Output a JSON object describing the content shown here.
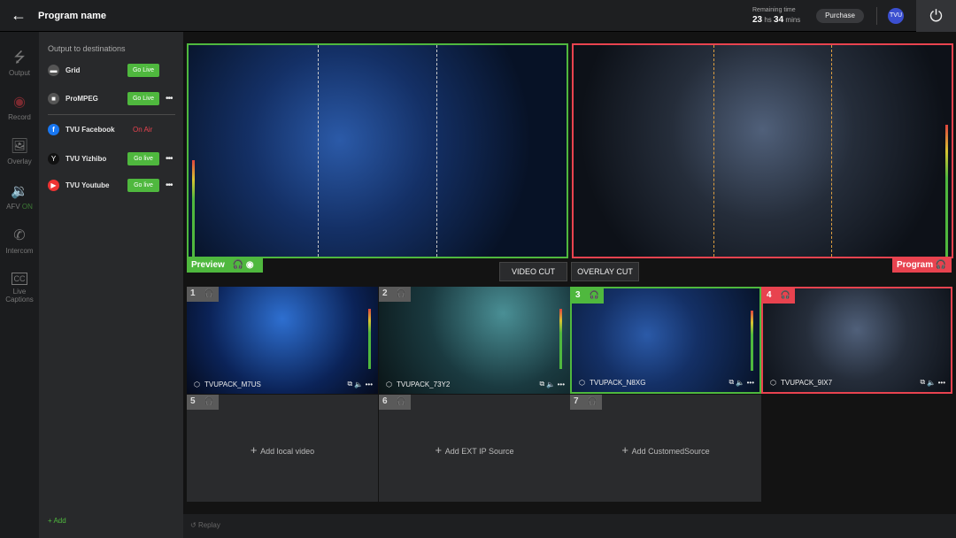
{
  "header": {
    "title": "Program name",
    "remaining_label": "Remaining time",
    "hours": "23",
    "hours_unit": "hs",
    "mins": "34",
    "mins_unit": "mins",
    "purchase": "Purchase",
    "avatar": "TVU"
  },
  "rail": [
    {
      "label": "Output",
      "icon": "output-icon"
    },
    {
      "label": "Record",
      "icon": "record-icon"
    },
    {
      "label": "Overlay",
      "icon": "overlay-icon"
    },
    {
      "label": "AFV",
      "status": "ON",
      "icon": "speaker-icon"
    },
    {
      "label": "Intercom",
      "icon": "phone-icon"
    },
    {
      "label": "Live Captions",
      "icon": "cc-icon"
    }
  ],
  "panel": {
    "title": "Output to destinations",
    "add": "Add",
    "destinations": [
      {
        "name": "Grid",
        "action": "Go Live",
        "more": false,
        "color": "#555"
      },
      {
        "name": "ProMPEG",
        "action": "Go Live",
        "more": true,
        "color": "#555"
      },
      {
        "name": "TVU Facebook",
        "status": "On Air",
        "color": "#1877f2"
      },
      {
        "name": "TVU Yizhibo",
        "action": "Go live",
        "more": true,
        "color": "#111"
      },
      {
        "name": "TVU Youtube",
        "action": "Go live",
        "more": true,
        "color": "#e33"
      }
    ]
  },
  "preview": {
    "label": "Preview"
  },
  "program": {
    "label": "Program"
  },
  "buttons": {
    "video_cut": "VIDEO CUT",
    "overlay_cut": "OVERLAY CUT"
  },
  "sources": [
    {
      "num": "1",
      "name": "TVUPACK_M7US"
    },
    {
      "num": "2",
      "name": "TVUPACK_73Y2"
    },
    {
      "num": "3",
      "name": "TVUPACK_N8XG"
    },
    {
      "num": "4",
      "name": "TVUPACK_9IX7"
    }
  ],
  "empty_sources": [
    {
      "num": "5",
      "label": "Add local video"
    },
    {
      "num": "6",
      "label": "Add EXT IP Source"
    },
    {
      "num": "7",
      "label": "Add CustomedSource"
    }
  ],
  "footer": {
    "replay": "Replay"
  },
  "colors": {
    "green": "#4fb83e",
    "red": "#e8434f",
    "accent": "#3b4fd0"
  }
}
